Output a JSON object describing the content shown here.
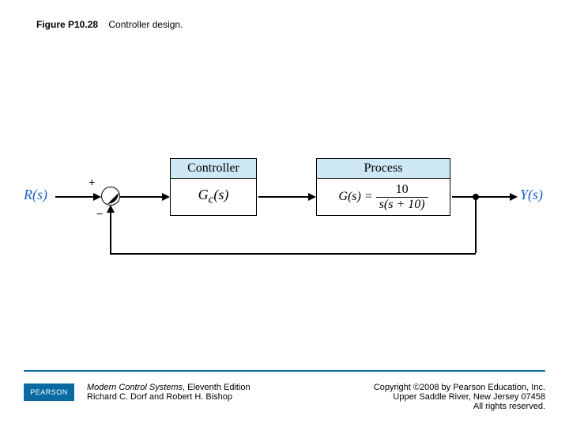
{
  "caption": {
    "fignum": "Figure P10.28",
    "text": "Controller design."
  },
  "diagram": {
    "input_label": "R(s)",
    "output_label": "Y(s)",
    "plus": "+",
    "minus": "−",
    "controller_header": "Controller",
    "controller_body": "G_c(s)",
    "process_header": "Process",
    "process_lhs": "G(s) =",
    "process_frac_num": "10",
    "process_frac_den": "s(s + 10)"
  },
  "chart_data": {
    "type": "block-diagram",
    "nodes": [
      {
        "id": "R",
        "kind": "source",
        "label": "R(s)"
      },
      {
        "id": "sum",
        "kind": "summing-junction",
        "inputs": [
          {
            "sign": "+",
            "from": "R"
          },
          {
            "sign": "-",
            "from": "feedback"
          }
        ]
      },
      {
        "id": "Gc",
        "kind": "block",
        "title": "Controller",
        "tf": "G_c(s)"
      },
      {
        "id": "G",
        "kind": "block",
        "title": "Process",
        "tf": "10 / ( s (s + 10) )"
      },
      {
        "id": "Y",
        "kind": "sink",
        "label": "Y(s)"
      }
    ],
    "edges": [
      {
        "from": "R",
        "to": "sum"
      },
      {
        "from": "sum",
        "to": "Gc"
      },
      {
        "from": "Gc",
        "to": "G"
      },
      {
        "from": "G",
        "to": "Y"
      },
      {
        "from": "G",
        "to": "sum",
        "id": "feedback",
        "feedback": true
      }
    ],
    "feedback": "unity-negative"
  },
  "footer": {
    "publisher_badge": "PEARSON",
    "book_title": "Modern Control Systems",
    "book_edition": ", Eleventh Edition",
    "authors": "Richard C. Dorf and Robert H. Bishop",
    "copyright_line1": "Copyright ©2008 by Pearson Education, Inc.",
    "copyright_line2": "Upper Saddle River, New Jersey 07458",
    "copyright_line3": "All rights reserved."
  }
}
